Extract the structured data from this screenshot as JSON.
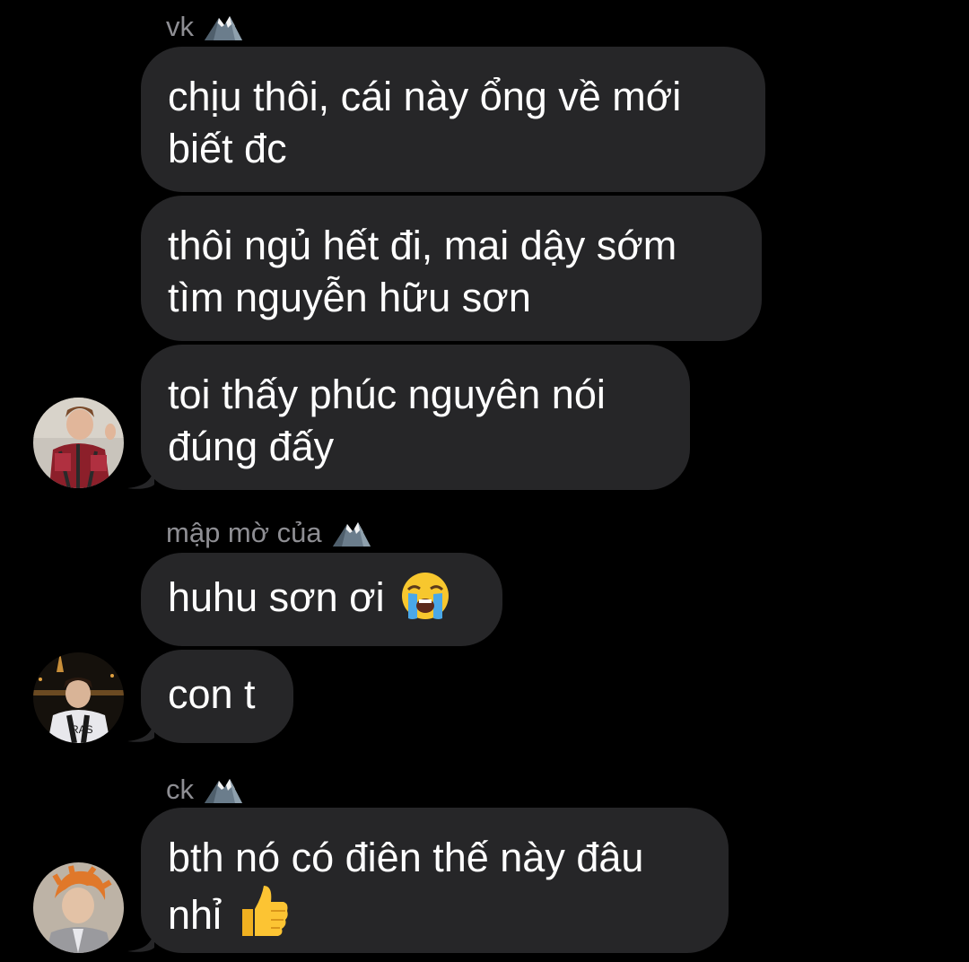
{
  "messages": [
    {
      "sender": "vk",
      "sender_emoji": "snow-capped-mountain-emoji"
    },
    {
      "text": "chịu thôi, cái này ổng về mới biết đc"
    },
    {
      "text": "thôi ngủ hết đi, mai dậy sớm tìm nguyễn hữu sơn"
    },
    {
      "text": "toi thấy phúc nguyên nói đúng đấy"
    },
    {
      "sender": "mập mờ của",
      "sender_emoji": "snow-capped-mountain-emoji",
      "text": "huhu sơn ơi",
      "emoji": "loudly-crying-face-emoji"
    },
    {
      "text": "con t"
    },
    {
      "sender": "ck",
      "sender_emoji": "snow-capped-mountain-emoji",
      "text": "bth nó có điên thế này đâu nhỉ",
      "emoji": "thumbs-up-emoji"
    }
  ],
  "colors": {
    "background": "#000000",
    "bubble": "#262628",
    "sender_text": "#8e8e93",
    "message_text": "#ffffff"
  }
}
